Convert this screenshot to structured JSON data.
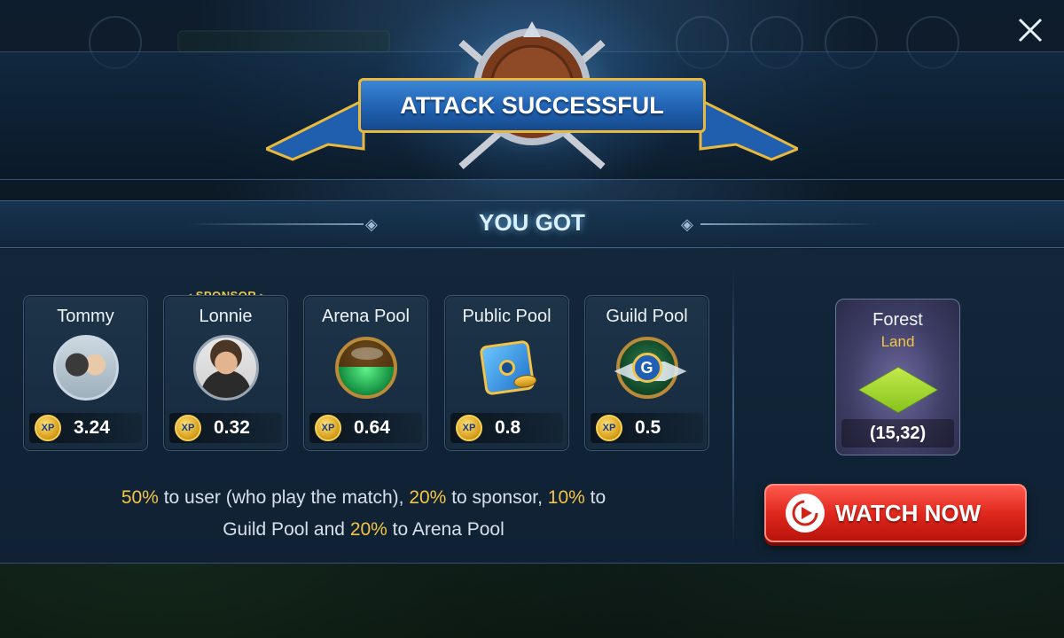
{
  "dialog": {
    "title": "ATTACK SUCCESSFUL",
    "section_title": "YOU GOT",
    "close_label": "✕"
  },
  "rewards": [
    {
      "name": "Tommy",
      "xp_label": "XP",
      "xp": "3.24",
      "icon": "tommy-avatar"
    },
    {
      "name": "Lonnie",
      "tag": "SPONSOR",
      "xp_label": "XP",
      "xp": "0.32",
      "icon": "lonnie-avatar"
    },
    {
      "name": "Arena Pool",
      "xp_label": "XP",
      "xp": "0.64",
      "icon": "arena-pool-orb-icon"
    },
    {
      "name": "Public Pool",
      "xp_label": "XP",
      "xp": "0.8",
      "icon": "public-pool-cube-icon"
    },
    {
      "name": "Guild Pool",
      "xp_label": "XP",
      "xp": "0.5",
      "icon": "guild-emblem-icon"
    }
  ],
  "land": {
    "name": "Forest",
    "type": "Land",
    "coords": "(15,32)"
  },
  "note": {
    "p1": "50%",
    "t1": " to user (who play the match), ",
    "p2": "20%",
    "t2": " to sponsor, ",
    "p3": "10%",
    "t3": " to",
    "t4": "Guild Pool and ",
    "p4": "20%",
    "t5": " to Arena Pool"
  },
  "watch_button": {
    "label": "WATCH NOW"
  },
  "colors": {
    "accent_gold": "#f2c545",
    "button_red": "#e0281e",
    "banner_blue": "#1f5fae"
  }
}
